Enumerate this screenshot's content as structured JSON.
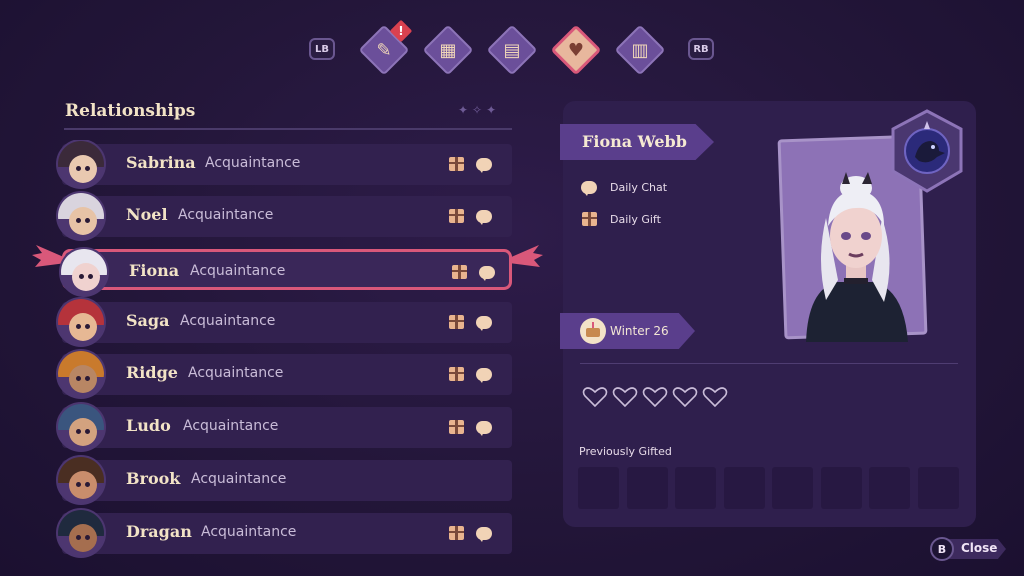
{
  "controls": {
    "left_shoulder": "LB",
    "right_shoulder": "RB",
    "close_button": "B",
    "close_label": "Close"
  },
  "tabs": [
    {
      "icon": "quest-scroll-icon",
      "active": false,
      "alert": "!"
    },
    {
      "icon": "map-icon",
      "active": false
    },
    {
      "icon": "calendar-icon",
      "active": false
    },
    {
      "icon": "heart-icon",
      "active": true
    },
    {
      "icon": "book-icon",
      "active": false
    }
  ],
  "panel": {
    "title": "Relationships"
  },
  "relationships": [
    {
      "name": "Sabrina",
      "status": "Acquaintance",
      "gift": true,
      "chat": true,
      "selected": false
    },
    {
      "name": "Noel",
      "status": "Acquaintance",
      "gift": true,
      "chat": true,
      "selected": false
    },
    {
      "name": "Fiona",
      "status": "Acquaintance",
      "gift": true,
      "chat": true,
      "selected": true
    },
    {
      "name": "Saga",
      "status": "Acquaintance",
      "gift": true,
      "chat": true,
      "selected": false
    },
    {
      "name": "Ridge",
      "status": "Acquaintance",
      "gift": true,
      "chat": true,
      "selected": false
    },
    {
      "name": "Ludo",
      "status": "Acquaintance",
      "gift": true,
      "chat": true,
      "selected": false
    },
    {
      "name": "Brook",
      "status": "Acquaintance",
      "gift": false,
      "chat": false,
      "selected": false
    },
    {
      "name": "Dragan",
      "status": "Acquaintance",
      "gift": true,
      "chat": true,
      "selected": false
    }
  ],
  "detail": {
    "full_name": "Fiona Webb",
    "daily_chat": "Daily Chat",
    "daily_gift": "Daily Gift",
    "birthday": "Winter 26",
    "hearts_filled": 0,
    "hearts_total": 5,
    "previously_gifted_label": "Previously Gifted"
  },
  "colors": {
    "accent": "#d9587a",
    "banner": "#5a3e8c",
    "panel": "#2f1f4d",
    "gold": "#e9b48f"
  }
}
